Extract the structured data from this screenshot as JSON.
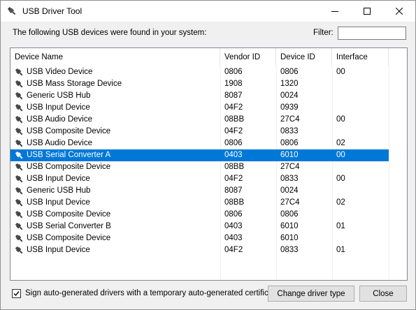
{
  "window": {
    "title": "USB Driver Tool"
  },
  "header": {
    "found_text": "The following USB devices were found in your system:",
    "filter_label": "Filter:",
    "filter_value": ""
  },
  "table": {
    "columns": [
      "Device Name",
      "Vendor ID",
      "Device ID",
      "Interface"
    ],
    "selected_index": 7,
    "rows": [
      {
        "name": "USB Video Device",
        "vendor": "0806",
        "device": "0806",
        "interface": "00"
      },
      {
        "name": "USB Mass Storage Device",
        "vendor": "1908",
        "device": "1320",
        "interface": ""
      },
      {
        "name": "Generic USB Hub",
        "vendor": "8087",
        "device": "0024",
        "interface": ""
      },
      {
        "name": "USB Input Device",
        "vendor": "04F2",
        "device": "0939",
        "interface": ""
      },
      {
        "name": "USB Audio Device",
        "vendor": "08BB",
        "device": "27C4",
        "interface": "00"
      },
      {
        "name": "USB Composite Device",
        "vendor": "04F2",
        "device": "0833",
        "interface": ""
      },
      {
        "name": "USB Audio Device",
        "vendor": "0806",
        "device": "0806",
        "interface": "02"
      },
      {
        "name": "USB Serial Converter A",
        "vendor": "0403",
        "device": "6010",
        "interface": "00"
      },
      {
        "name": "USB Composite Device",
        "vendor": "08BB",
        "device": "27C4",
        "interface": ""
      },
      {
        "name": "USB Input Device",
        "vendor": "04F2",
        "device": "0833",
        "interface": "00"
      },
      {
        "name": "Generic USB Hub",
        "vendor": "8087",
        "device": "0024",
        "interface": ""
      },
      {
        "name": "USB Input Device",
        "vendor": "08BB",
        "device": "27C4",
        "interface": "02"
      },
      {
        "name": "USB Composite Device",
        "vendor": "0806",
        "device": "0806",
        "interface": ""
      },
      {
        "name": "USB Serial Converter B",
        "vendor": "0403",
        "device": "6010",
        "interface": "01"
      },
      {
        "name": "USB Composite Device",
        "vendor": "0403",
        "device": "6010",
        "interface": ""
      },
      {
        "name": "USB Input Device",
        "vendor": "04F2",
        "device": "0833",
        "interface": "01"
      }
    ]
  },
  "footer": {
    "checkbox_checked": true,
    "checkbox_label": "Sign auto-generated drivers with a temporary auto-generated certificate",
    "change_button": "Change driver type",
    "close_button": "Close"
  },
  "colors": {
    "selection": "#0078d7",
    "window_bg": "#f0f0f0"
  },
  "icons": {
    "title": "usb-plug-icon",
    "row": "usb-plug-icon",
    "minimize": "minimize-icon",
    "maximize": "maximize-icon",
    "close": "close-icon",
    "checkbox": "checkmark-icon"
  }
}
